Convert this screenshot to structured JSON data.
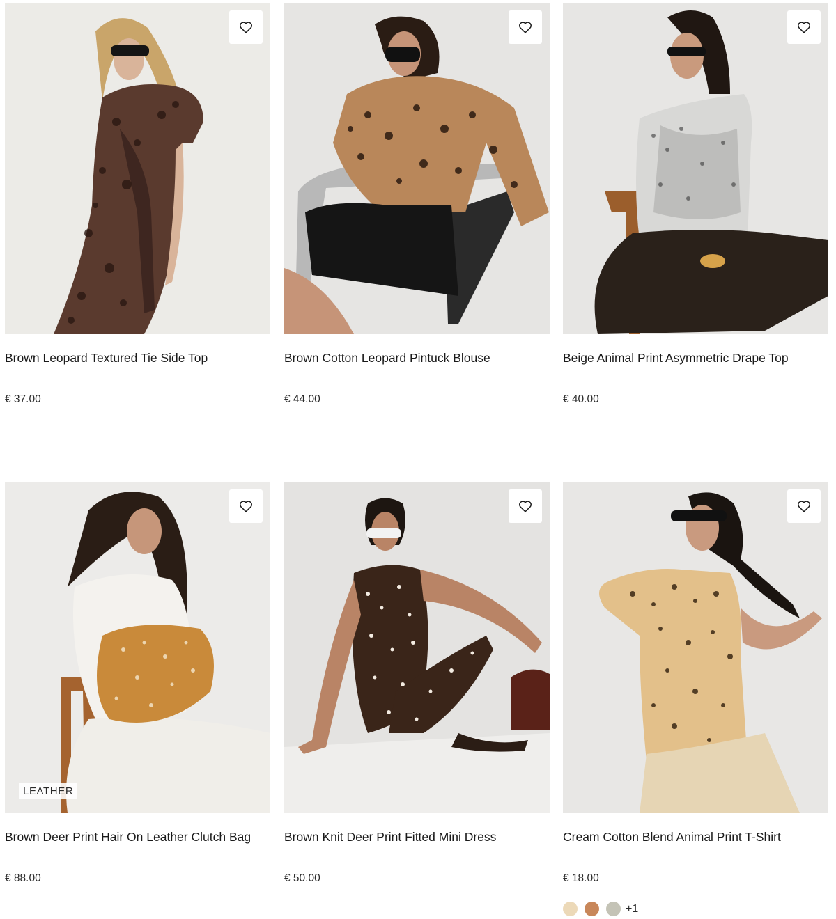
{
  "products": [
    {
      "title": "Brown Leopard Textured Tie Side Top",
      "price": "€ 37.00"
    },
    {
      "title": "Brown Cotton Leopard Pintuck Blouse",
      "price": "€ 44.00"
    },
    {
      "title": "Beige Animal Print Asymmetric Drape Top",
      "price": "€ 40.00"
    },
    {
      "title": "Brown Deer Print Hair On Leather Clutch Bag",
      "price": "€ 88.00",
      "badge": "LEATHER"
    },
    {
      "title": "Brown Knit Deer Print Fitted Mini Dress",
      "price": "€ 50.00"
    },
    {
      "title": "Cream Cotton Blend Animal Print T-Shirt",
      "price": "€ 18.00",
      "swatches": [
        "#ecd9b8",
        "#c8875a",
        "#c4c3b6"
      ],
      "more_colors": "+1"
    }
  ],
  "icons": {
    "wishlist": "heart-outline-icon"
  },
  "colors": {
    "image_bg": "#e9e9e8",
    "text": "#1a1a1a"
  }
}
